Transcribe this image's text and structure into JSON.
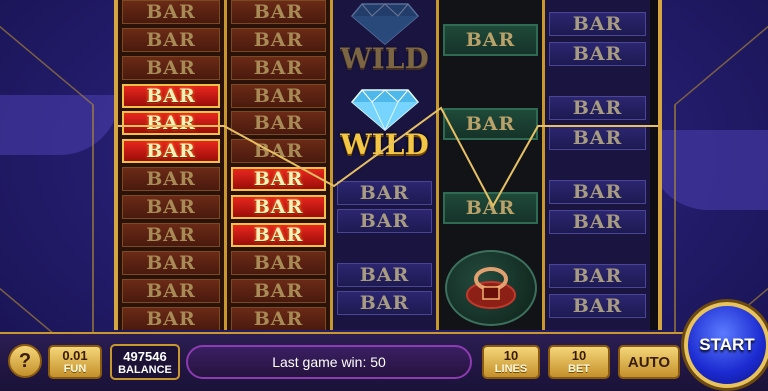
{
  "reels": {
    "bar_label": "BAR",
    "wild_label": "WILD"
  },
  "controls": {
    "help_label": "?",
    "fun_value": "0.01",
    "fun_label": "FUN",
    "balance_value": "497546",
    "balance_label": "BALANCE",
    "last_game_win": "Last game win: 50",
    "lines_value": "10",
    "lines_label": "LINES",
    "bet_value": "10",
    "bet_label": "BET",
    "auto_label": "AUTO",
    "start_label": "START"
  },
  "colors": {
    "frame_gold": "#d6a640",
    "highlight_red": "#e8271d",
    "win_line": "#e6c063"
  }
}
